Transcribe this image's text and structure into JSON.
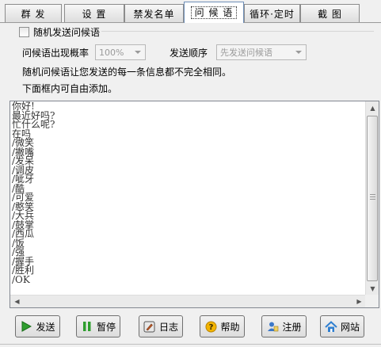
{
  "tabs": [
    "群 发",
    "设 置",
    "禁发名单",
    "问 候 语",
    "循环·定时",
    "截 图"
  ],
  "active_tab": 3,
  "random_greeting_label": "随机发送问候语",
  "probability_label": "问候语出现概率",
  "probability_value": "100%",
  "order_label": "发送顺序",
  "order_value": "先发送问候语",
  "info_line1": "随机问候语让您发送的每一条信息都不完全相同。",
  "info_line2": "下面框内可自由添加。",
  "greetings": [
    "你好!",
    "最近好吗?",
    "忙什么呢?",
    "在吗",
    "/微笑",
    "/撇嘴",
    "/发呆",
    "/调皮",
    "/呲牙",
    "/酷",
    "/可爱",
    "/憨笑",
    "/大兵",
    "/鼓掌",
    "/西瓜",
    "/饭",
    "/强",
    "/握手",
    "/胜利",
    "/OK"
  ],
  "buttons": {
    "send": "发送",
    "pause": "暂停",
    "log": "日志",
    "help": "帮助",
    "register": "注册",
    "website": "网站"
  },
  "icons": {
    "send": "play-icon",
    "pause": "pause-icon",
    "log": "log-icon",
    "help": "help-icon",
    "register": "register-icon",
    "website": "home-icon"
  }
}
